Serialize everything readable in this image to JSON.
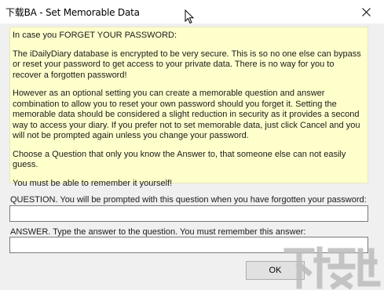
{
  "window": {
    "title": "下载BA - Set Memorable Data",
    "close_icon": "close-icon"
  },
  "info": {
    "paragraphs": [
      "In case you FORGET YOUR PASSWORD:",
      "The iDailyDiary database is encrypted to be very secure. This is so no one else can bypass or reset your password to get access to your private data. There is no way for you to recover a forgotten password!",
      "However as an optional setting you can create a memorable question and answer combination to allow you to reset your own password should you forget it. Setting the memorable data should be considered a slight reduction in security as it provides a second way to access your diary. If you prefer not to set memorable data, just click Cancel and you will not be prompted again unless you change your password.",
      "Choose a Question that only you know the Answer to, that someone else can not easily guess.",
      "You must be able to remember it yourself!"
    ]
  },
  "question": {
    "label": "QUESTION. You will be prompted with this question when you have forgotten your password:",
    "value": ""
  },
  "answer": {
    "label": "ANSWER. Type the answer to the question. You must remember this answer:",
    "value": ""
  },
  "buttons": {
    "ok_label": "OK"
  },
  "watermark": {
    "text": "下载吧"
  }
}
